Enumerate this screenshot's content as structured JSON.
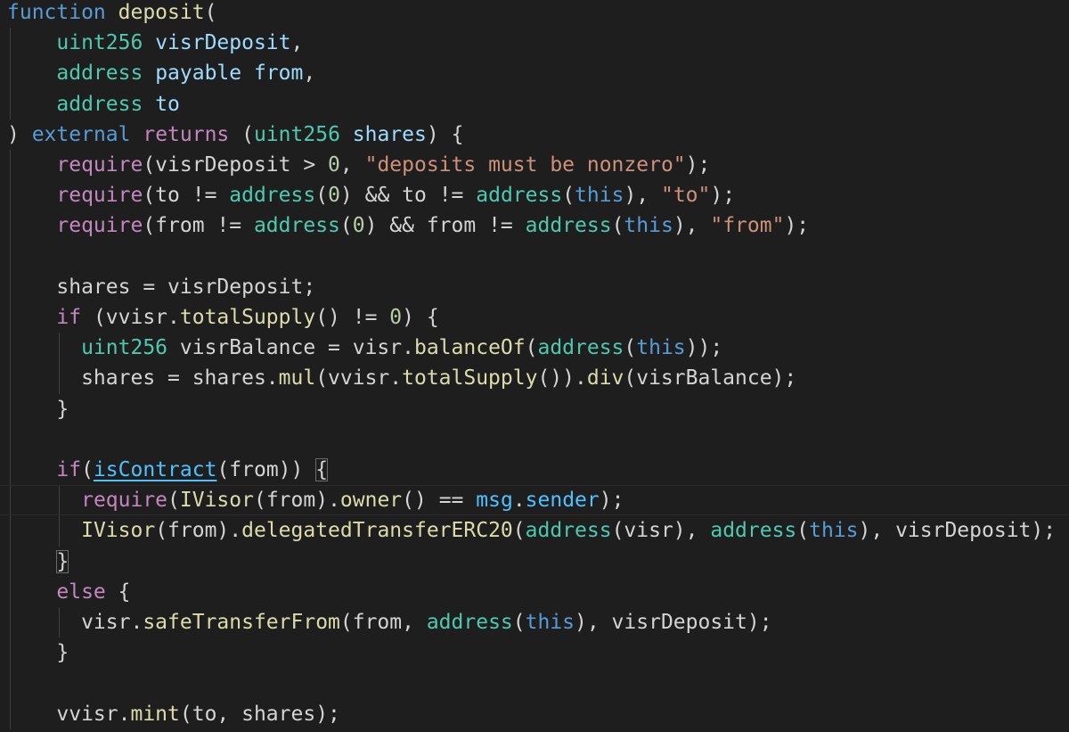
{
  "editor": {
    "theme": {
      "background": "#1e1e1e",
      "keyword": "#569cd6",
      "control": "#c586c0",
      "type": "#4ec9b0",
      "function": "#dcdcaa",
      "parameter": "#9cdcfe",
      "string": "#ce9178",
      "number": "#b5cea8",
      "plain": "#d4d4d4"
    },
    "lines": [
      {
        "tokens": [
          {
            "text": "function",
            "c": "keyword"
          },
          {
            "text": " ",
            "c": "plain"
          },
          {
            "text": "deposit",
            "c": "func"
          },
          {
            "text": "(",
            "c": "plain"
          }
        ]
      },
      {
        "tokens": [
          {
            "text": "    ",
            "c": "plain"
          },
          {
            "text": "uint256",
            "c": "type"
          },
          {
            "text": " ",
            "c": "plain"
          },
          {
            "text": "visrDeposit",
            "c": "param"
          },
          {
            "text": ",",
            "c": "plain"
          }
        ]
      },
      {
        "tokens": [
          {
            "text": "    ",
            "c": "plain"
          },
          {
            "text": "address",
            "c": "type"
          },
          {
            "text": " ",
            "c": "plain"
          },
          {
            "text": "payable",
            "c": "param"
          },
          {
            "text": " ",
            "c": "plain"
          },
          {
            "text": "from",
            "c": "param"
          },
          {
            "text": ",",
            "c": "plain"
          }
        ]
      },
      {
        "tokens": [
          {
            "text": "    ",
            "c": "plain"
          },
          {
            "text": "address",
            "c": "type"
          },
          {
            "text": " ",
            "c": "plain"
          },
          {
            "text": "to",
            "c": "param"
          }
        ]
      },
      {
        "tokens": [
          {
            "text": ") ",
            "c": "plain"
          },
          {
            "text": "external",
            "c": "keyword"
          },
          {
            "text": " ",
            "c": "plain"
          },
          {
            "text": "returns",
            "c": "control"
          },
          {
            "text": " (",
            "c": "plain"
          },
          {
            "text": "uint256",
            "c": "type"
          },
          {
            "text": " ",
            "c": "plain"
          },
          {
            "text": "shares",
            "c": "param"
          },
          {
            "text": ") {",
            "c": "plain"
          }
        ]
      },
      {
        "tokens": [
          {
            "text": "    ",
            "c": "plain"
          },
          {
            "text": "require",
            "c": "control"
          },
          {
            "text": "(visrDeposit > ",
            "c": "plain"
          },
          {
            "text": "0",
            "c": "number"
          },
          {
            "text": ", ",
            "c": "plain"
          },
          {
            "text": "\"deposits must be nonzero\"",
            "c": "string"
          },
          {
            "text": ");",
            "c": "plain"
          }
        ]
      },
      {
        "tokens": [
          {
            "text": "    ",
            "c": "plain"
          },
          {
            "text": "require",
            "c": "control"
          },
          {
            "text": "(to != ",
            "c": "plain"
          },
          {
            "text": "address",
            "c": "type"
          },
          {
            "text": "(",
            "c": "plain"
          },
          {
            "text": "0",
            "c": "number"
          },
          {
            "text": ") && to != ",
            "c": "plain"
          },
          {
            "text": "address",
            "c": "type"
          },
          {
            "text": "(",
            "c": "plain"
          },
          {
            "text": "this",
            "c": "this"
          },
          {
            "text": "), ",
            "c": "plain"
          },
          {
            "text": "\"to\"",
            "c": "string"
          },
          {
            "text": ");",
            "c": "plain"
          }
        ]
      },
      {
        "tokens": [
          {
            "text": "    ",
            "c": "plain"
          },
          {
            "text": "require",
            "c": "control"
          },
          {
            "text": "(from != ",
            "c": "plain"
          },
          {
            "text": "address",
            "c": "type"
          },
          {
            "text": "(",
            "c": "plain"
          },
          {
            "text": "0",
            "c": "number"
          },
          {
            "text": ") && from != ",
            "c": "plain"
          },
          {
            "text": "address",
            "c": "type"
          },
          {
            "text": "(",
            "c": "plain"
          },
          {
            "text": "this",
            "c": "this"
          },
          {
            "text": "), ",
            "c": "plain"
          },
          {
            "text": "\"from\"",
            "c": "string"
          },
          {
            "text": ");",
            "c": "plain"
          }
        ]
      },
      {
        "tokens": []
      },
      {
        "tokens": [
          {
            "text": "    shares = visrDeposit;",
            "c": "plain"
          }
        ]
      },
      {
        "tokens": [
          {
            "text": "    ",
            "c": "plain"
          },
          {
            "text": "if",
            "c": "control"
          },
          {
            "text": " (vvisr.",
            "c": "plain"
          },
          {
            "text": "totalSupply",
            "c": "func"
          },
          {
            "text": "() != ",
            "c": "plain"
          },
          {
            "text": "0",
            "c": "number"
          },
          {
            "text": ") {",
            "c": "plain"
          }
        ]
      },
      {
        "tokens": [
          {
            "text": "      ",
            "c": "plain"
          },
          {
            "text": "uint256",
            "c": "type"
          },
          {
            "text": " visrBalance = visr.",
            "c": "plain"
          },
          {
            "text": "balanceOf",
            "c": "func"
          },
          {
            "text": "(",
            "c": "plain"
          },
          {
            "text": "address",
            "c": "type"
          },
          {
            "text": "(",
            "c": "plain"
          },
          {
            "text": "this",
            "c": "this"
          },
          {
            "text": "));",
            "c": "plain"
          }
        ]
      },
      {
        "tokens": [
          {
            "text": "      shares = shares.",
            "c": "plain"
          },
          {
            "text": "mul",
            "c": "func"
          },
          {
            "text": "(vvisr.",
            "c": "plain"
          },
          {
            "text": "totalSupply",
            "c": "func"
          },
          {
            "text": "()).",
            "c": "plain"
          },
          {
            "text": "div",
            "c": "func"
          },
          {
            "text": "(visrBalance);",
            "c": "plain"
          }
        ]
      },
      {
        "tokens": [
          {
            "text": "    }",
            "c": "plain"
          }
        ]
      },
      {
        "tokens": []
      },
      {
        "tokens": [
          {
            "text": "    ",
            "c": "plain"
          },
          {
            "text": "if",
            "c": "control"
          },
          {
            "text": "(",
            "c": "plain"
          },
          {
            "text": "isContract",
            "c": "link",
            "u": true
          },
          {
            "text": "(from)) ",
            "c": "plain"
          },
          {
            "text": "{",
            "c": "plain",
            "box": true
          }
        ]
      },
      {
        "current": true,
        "tokens": [
          {
            "text": "      ",
            "c": "plain"
          },
          {
            "text": "require",
            "c": "control"
          },
          {
            "text": "(",
            "c": "plain"
          },
          {
            "text": "IVisor",
            "c": "func"
          },
          {
            "text": "(from).",
            "c": "plain"
          },
          {
            "text": "owner",
            "c": "func"
          },
          {
            "text": "() == ",
            "c": "plain"
          },
          {
            "text": "msg",
            "c": "link"
          },
          {
            "text": ".",
            "c": "plain"
          },
          {
            "text": "sender",
            "c": "link"
          },
          {
            "text": ");",
            "c": "plain"
          }
        ]
      },
      {
        "tokens": [
          {
            "text": "      ",
            "c": "plain"
          },
          {
            "text": "IVisor",
            "c": "func"
          },
          {
            "text": "(from).",
            "c": "plain"
          },
          {
            "text": "delegatedTransferERC20",
            "c": "func"
          },
          {
            "text": "(",
            "c": "plain"
          },
          {
            "text": "address",
            "c": "type"
          },
          {
            "text": "(visr), ",
            "c": "plain"
          },
          {
            "text": "address",
            "c": "type"
          },
          {
            "text": "(",
            "c": "plain"
          },
          {
            "text": "this",
            "c": "this"
          },
          {
            "text": "), visrDeposit);",
            "c": "plain"
          }
        ]
      },
      {
        "tokens": [
          {
            "text": "    ",
            "c": "plain"
          },
          {
            "text": "}",
            "c": "plain",
            "box": true
          }
        ]
      },
      {
        "tokens": [
          {
            "text": "    ",
            "c": "plain"
          },
          {
            "text": "else",
            "c": "control"
          },
          {
            "text": " {",
            "c": "plain"
          }
        ]
      },
      {
        "tokens": [
          {
            "text": "      visr.",
            "c": "plain"
          },
          {
            "text": "safeTransferFrom",
            "c": "func"
          },
          {
            "text": "(from, ",
            "c": "plain"
          },
          {
            "text": "address",
            "c": "type"
          },
          {
            "text": "(",
            "c": "plain"
          },
          {
            "text": "this",
            "c": "this"
          },
          {
            "text": "), visrDeposit);",
            "c": "plain"
          }
        ]
      },
      {
        "tokens": [
          {
            "text": "    }",
            "c": "plain"
          }
        ]
      },
      {
        "tokens": []
      },
      {
        "tokens": [
          {
            "text": "    vvisr.",
            "c": "plain"
          },
          {
            "text": "mint",
            "c": "func"
          },
          {
            "text": "(to, shares);",
            "c": "plain"
          }
        ]
      }
    ]
  }
}
